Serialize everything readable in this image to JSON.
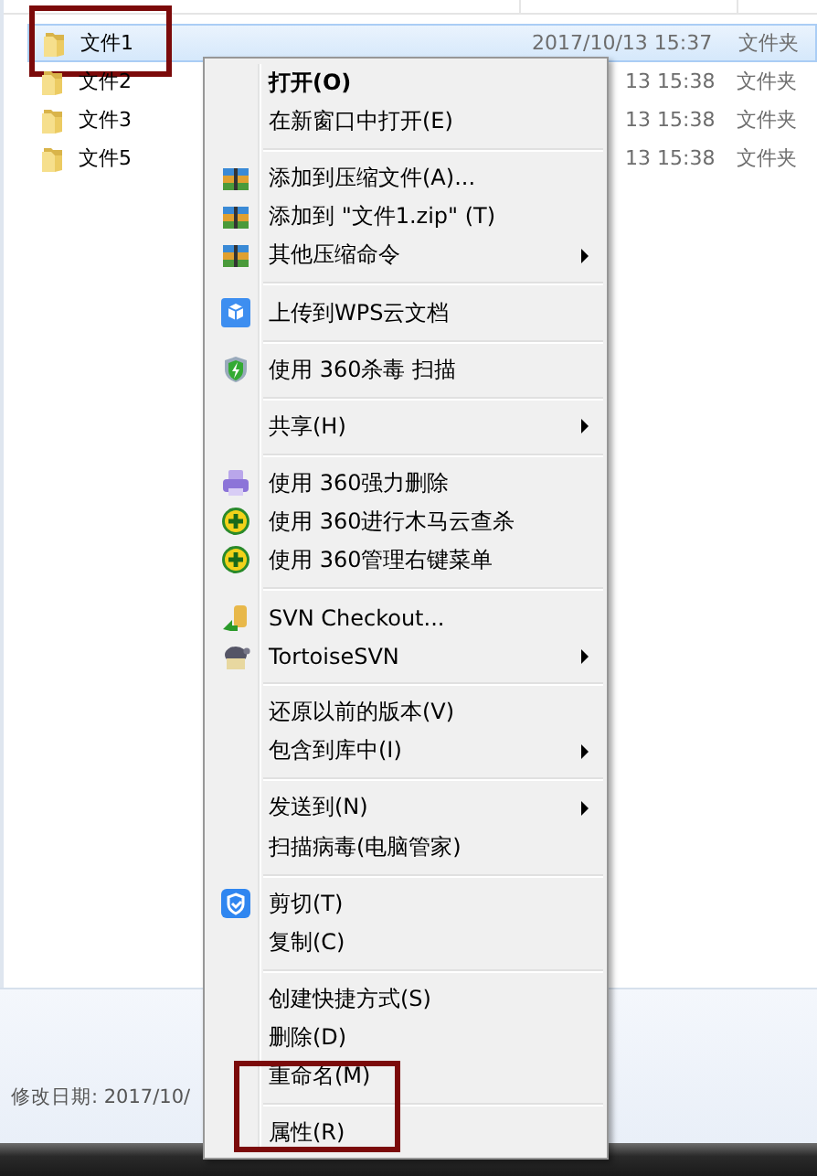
{
  "files": [
    {
      "name": "文件1",
      "modified": "2017/10/13 15:37",
      "type": "文件夹",
      "selected": true,
      "highlighted": true
    },
    {
      "name": "文件2",
      "modified": "13 15:38",
      "type": "文件夹",
      "selected": false,
      "highlighted": false
    },
    {
      "name": "文件3",
      "modified": "13 15:38",
      "type": "文件夹",
      "selected": false,
      "highlighted": false
    },
    {
      "name": "文件5",
      "modified": "13 15:38",
      "type": "文件夹",
      "selected": false,
      "highlighted": false
    }
  ],
  "details_pane": {
    "text": "修改日期: 2017/10/"
  },
  "context_menu": {
    "groups": [
      [
        {
          "label": "打开(O)",
          "default": true,
          "submenu": false,
          "highlighted": false
        },
        {
          "label": "在新窗口中打开(E)",
          "default": false,
          "submenu": false,
          "highlighted": false
        }
      ],
      [
        {
          "label": "添加到压缩文件(A)...",
          "default": false,
          "submenu": false,
          "highlighted": false
        },
        {
          "label": "添加到 \"文件1.zip\" (T)",
          "default": false,
          "submenu": false,
          "highlighted": false
        },
        {
          "label": "其他压缩命令",
          "default": false,
          "submenu": true,
          "highlighted": false
        }
      ],
      [
        {
          "label": "上传到WPS云文档",
          "default": false,
          "submenu": false,
          "highlighted": false
        }
      ],
      [
        {
          "label": "使用 360杀毒 扫描",
          "default": false,
          "submenu": false,
          "highlighted": false
        }
      ],
      [
        {
          "label": "共享(H)",
          "default": false,
          "submenu": true,
          "highlighted": false
        }
      ],
      [
        {
          "label": "使用 360强力删除",
          "default": false,
          "submenu": false,
          "highlighted": false
        },
        {
          "label": "使用 360进行木马云查杀",
          "default": false,
          "submenu": false,
          "highlighted": false
        },
        {
          "label": "使用 360管理右键菜单",
          "default": false,
          "submenu": false,
          "highlighted": false
        }
      ],
      [
        {
          "label": "SVN Checkout...",
          "default": false,
          "submenu": false,
          "highlighted": false
        },
        {
          "label": "TortoiseSVN",
          "default": false,
          "submenu": true,
          "highlighted": false
        }
      ],
      [
        {
          "label": "还原以前的版本(V)",
          "default": false,
          "submenu": false,
          "highlighted": false
        },
        {
          "label": "包含到库中(I)",
          "default": false,
          "submenu": true,
          "highlighted": false
        }
      ],
      [
        {
          "label": "发送到(N)",
          "default": false,
          "submenu": true,
          "highlighted": false
        },
        {
          "label": "扫描病毒(电脑管家)",
          "default": false,
          "submenu": false,
          "highlighted": false
        }
      ],
      [
        {
          "label": "剪切(T)",
          "default": false,
          "submenu": false,
          "highlighted": false
        },
        {
          "label": "复制(C)",
          "default": false,
          "submenu": false,
          "highlighted": false
        }
      ],
      [
        {
          "label": "创建快捷方式(S)",
          "default": false,
          "submenu": false,
          "highlighted": false
        },
        {
          "label": "删除(D)",
          "default": false,
          "submenu": false,
          "highlighted": false
        },
        {
          "label": "重命名(M)",
          "default": false,
          "submenu": false,
          "highlighted": false
        }
      ],
      [
        {
          "label": "属性(R)",
          "default": false,
          "submenu": false,
          "highlighted": true
        }
      ]
    ]
  }
}
